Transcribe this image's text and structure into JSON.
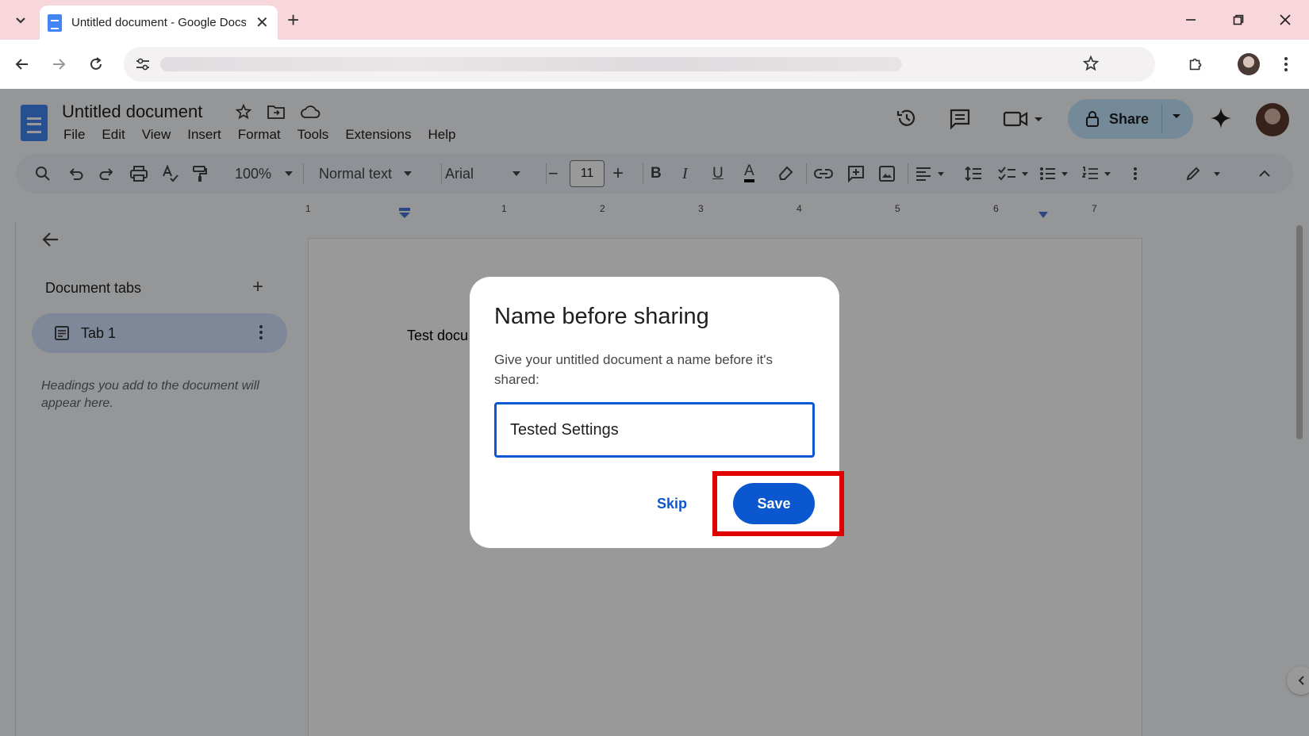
{
  "browser": {
    "tab_title": "Untitled document - Google Docs",
    "tab_close": "✕",
    "new_tab": "+"
  },
  "docs": {
    "title": "Untitled document",
    "menu": [
      "File",
      "Edit",
      "View",
      "Insert",
      "Format",
      "Tools",
      "Extensions",
      "Help"
    ],
    "share_label": "Share",
    "toolbar": {
      "zoom": "100%",
      "style": "Normal text",
      "font": "Arial",
      "font_size": "11",
      "minus": "−",
      "plus": "+",
      "bold": "B",
      "italic": "I",
      "underline": "U",
      "text_color": "A"
    },
    "ruler_numbers": [
      "1",
      "1",
      "2",
      "3",
      "4",
      "5",
      "6",
      "7"
    ],
    "body_text": "Test docu"
  },
  "sidebar": {
    "heading": "Document tabs",
    "add": "+",
    "tab_label": "Tab 1",
    "note": "Headings you add to the document will appear here."
  },
  "dialog": {
    "title": "Name before sharing",
    "description": "Give your untitled document a name before it's shared:",
    "input_value": "Tested Settings",
    "skip_label": "Skip",
    "save_label": "Save"
  },
  "colors": {
    "accent": "#0b57d0",
    "share_bg": "#c2e7ff",
    "tab_strip": "#f8d7dc",
    "highlight": "#e00000"
  }
}
